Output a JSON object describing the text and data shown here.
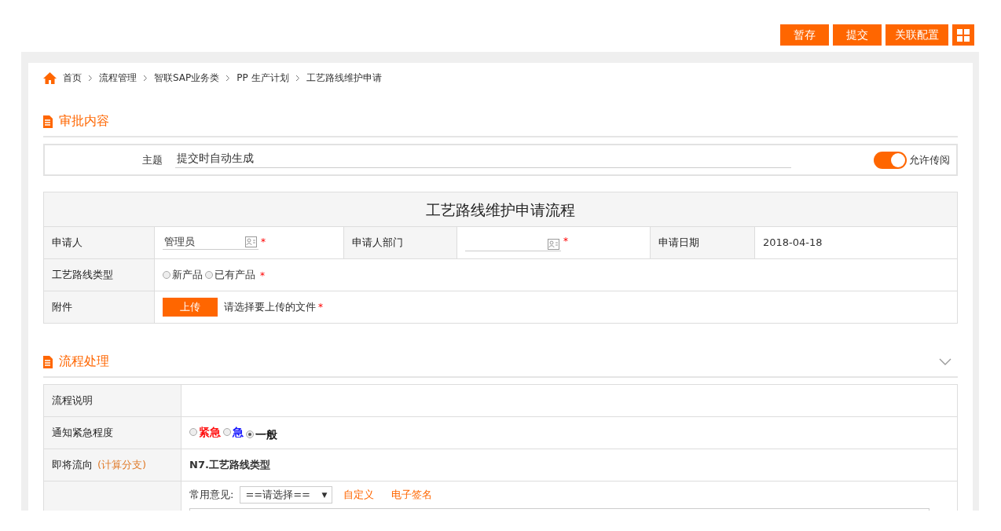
{
  "toolbar": {
    "buttons": [
      "暂存",
      "提交",
      "关联配置"
    ]
  },
  "breadcrumb": [
    "首页",
    "流程管理",
    "智联SAP业务类",
    "PP 生产计划",
    "工艺路线维护申请"
  ],
  "approval": {
    "title": "审批内容",
    "subject_label": "主题",
    "subject_value": "提交时自动生成",
    "toggle": {
      "label": "允许传阅",
      "on": true
    }
  },
  "form": {
    "title": "工艺路线维护申请流程",
    "applicant": {
      "label": "申请人",
      "value": "管理员",
      "mark": "*"
    },
    "department": {
      "label": "申请人部门",
      "mark": "*"
    },
    "date": {
      "label": "申请日期",
      "value": "2018-04-18"
    },
    "route_type": {
      "label": "工艺路线类型",
      "options": [
        {
          "label": "新产品",
          "selected": false
        },
        {
          "label": "已有产品",
          "selected": false
        }
      ],
      "mark": "*"
    },
    "attachment": {
      "label": "附件",
      "button": "上传",
      "hint": "请选择要上传的文件",
      "mark": "*"
    }
  },
  "process": {
    "title": "流程处理",
    "expanded": true,
    "description_label": "流程说明",
    "urgency": {
      "label": "通知紧急程度",
      "options": [
        {
          "label": "紧急",
          "selected": false,
          "color": "#ff0000"
        },
        {
          "label": "急",
          "selected": false,
          "color": "#0000ff"
        },
        {
          "label": "一般",
          "selected": true,
          "color": "#000000"
        }
      ]
    },
    "next": {
      "label": "即将流向",
      "note": "(计算分支)",
      "value": "N7.工艺路线类型"
    },
    "opinion": {
      "label": "常用意见:",
      "select": "==请选择==",
      "select_arrow": "▼",
      "links": [
        "自定义",
        "电子签名"
      ]
    }
  }
}
